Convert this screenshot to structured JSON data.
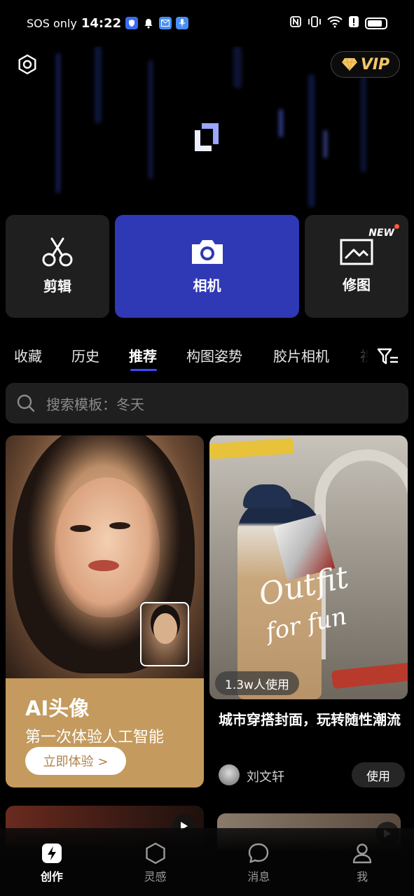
{
  "status_bar": {
    "carrier": "SOS only",
    "time": "14:22",
    "icons": [
      "shield-app-icon",
      "bell-icon",
      "mail-app-icon",
      "mic-app-icon",
      "nfc-icon",
      "vibrate-icon",
      "wifi-icon",
      "alert-icon",
      "battery-icon"
    ],
    "battery_level": 0.85
  },
  "header": {
    "vip_label": "VIP",
    "icons": [
      "settings-icon",
      "diamond-icon",
      "app-logo-icon"
    ]
  },
  "tools": [
    {
      "label": "剪辑",
      "icon": "scissors-icon"
    },
    {
      "label": "相机",
      "icon": "camera-icon",
      "highlight_color": "#2f38b5"
    },
    {
      "label": "修图",
      "icon": "picture-edit-icon",
      "badge": "NEW"
    }
  ],
  "tabs": [
    {
      "label": "收藏"
    },
    {
      "label": "历史"
    },
    {
      "label": "推荐",
      "active": true
    },
    {
      "label": "构图姿势"
    },
    {
      "label": "胶片相机"
    },
    {
      "label": "视"
    }
  ],
  "search": {
    "placeholder": "搜索模板：冬天"
  },
  "cards": {
    "left": {
      "title": "AI头像",
      "subtitle": "第一次体验人工智能",
      "cta": "立即体验 >",
      "accent": "#c49a5e"
    },
    "right": {
      "script_line1": "Outfit",
      "script_line2": "for fun",
      "use_count": "1.3w人使用",
      "title": "城市穿搭封面，玩转随性潮流",
      "author": "刘文轩",
      "use_label": "使用"
    }
  },
  "bottom_nav": [
    {
      "label": "创作",
      "icon": "create-icon",
      "active": true
    },
    {
      "label": "灵感",
      "icon": "hexagon-icon"
    },
    {
      "label": "消息",
      "icon": "chat-bubble-icon"
    },
    {
      "label": "我",
      "icon": "person-icon"
    }
  ]
}
